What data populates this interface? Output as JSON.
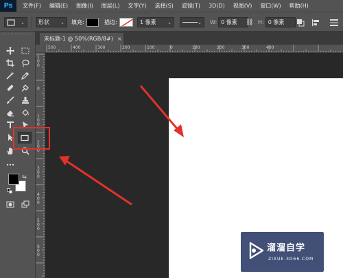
{
  "app": {
    "logo": "Ps"
  },
  "menu": [
    {
      "label": "文件(F)"
    },
    {
      "label": "编辑(E)"
    },
    {
      "label": "图像(I)"
    },
    {
      "label": "图层(L)"
    },
    {
      "label": "文字(Y)"
    },
    {
      "label": "选择(S)"
    },
    {
      "label": "滤镜(T)"
    },
    {
      "label": "3D(D)"
    },
    {
      "label": "视图(V)"
    },
    {
      "label": "窗口(W)"
    },
    {
      "label": "帮助(H)"
    }
  ],
  "options": {
    "mode_value": "形状",
    "fill_label": "填充:",
    "stroke_label": "描边:",
    "stroke_width_value": "1 像素",
    "w_label": "W:",
    "w_value": "0 像素",
    "h_label": "H:",
    "h_value": "0 像素",
    "fill_color": "#000000"
  },
  "document_tab": {
    "title": "未标题-1 @ 50%(RGB/8#)",
    "close_glyph": "×"
  },
  "rulers": {
    "horizontal": [
      "500",
      "400",
      "300",
      "200",
      "100",
      "0",
      "100",
      "200",
      "300",
      "400"
    ],
    "vertical": [
      "100",
      "0",
      "100",
      "200",
      "300",
      "400",
      "500",
      "600"
    ]
  },
  "tools": [
    {
      "name": "move-tool",
      "icon": "move-icon"
    },
    {
      "name": "marquee-tool",
      "icon": "marquee-icon"
    },
    {
      "name": "crop-tool",
      "icon": "crop-icon"
    },
    {
      "name": "lasso-tool",
      "icon": "lasso-icon"
    },
    {
      "name": "magic-wand-tool",
      "icon": "magic-wand-icon"
    },
    {
      "name": "eyedropper-tool",
      "icon": "eyedropper-icon"
    },
    {
      "name": "healing-tool",
      "icon": "bandage-icon"
    },
    {
      "name": "patch-tool",
      "icon": "patch-icon"
    },
    {
      "name": "brush-tool",
      "icon": "brush-icon"
    },
    {
      "name": "stamp-tool",
      "icon": "stamp-icon"
    },
    {
      "name": "eraser-tool",
      "icon": "eraser-icon"
    },
    {
      "name": "paint-bucket-tool",
      "icon": "bucket-icon"
    },
    {
      "name": "type-tool",
      "icon": "type-icon"
    },
    {
      "name": "pen-tool",
      "icon": "pen-icon"
    },
    {
      "name": "path-select-tool",
      "icon": "arrow-icon"
    },
    {
      "name": "rectangle-tool",
      "icon": "rectangle-icon",
      "active": true
    },
    {
      "name": "hand-tool",
      "icon": "hand-icon"
    },
    {
      "name": "zoom-tool",
      "icon": "zoom-icon"
    }
  ],
  "swatches": {
    "foreground": "#000000",
    "background": "#ffffff"
  },
  "annotation": {
    "color": "#e2322b"
  },
  "watermark": {
    "title": "溜溜自学",
    "subtitle": "ZIXUE.3D66.COM"
  }
}
